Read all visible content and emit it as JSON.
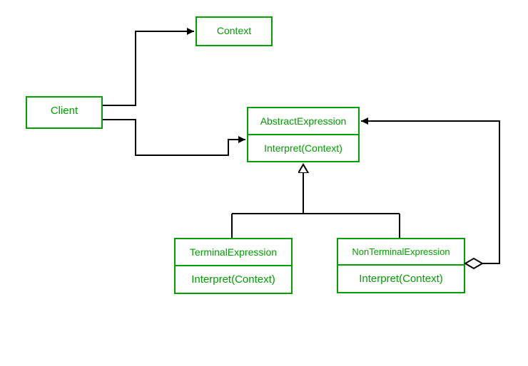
{
  "diagram": {
    "client": {
      "title": "Client"
    },
    "context": {
      "title": "Context"
    },
    "abstract": {
      "title": "AbstractExpression",
      "method": "Interpret(Context)"
    },
    "terminal": {
      "title": "TerminalExpression",
      "method": "Interpret(Context)"
    },
    "nonterminal": {
      "title": "NonTerminalExpression",
      "method": "Interpret(Context)"
    }
  }
}
